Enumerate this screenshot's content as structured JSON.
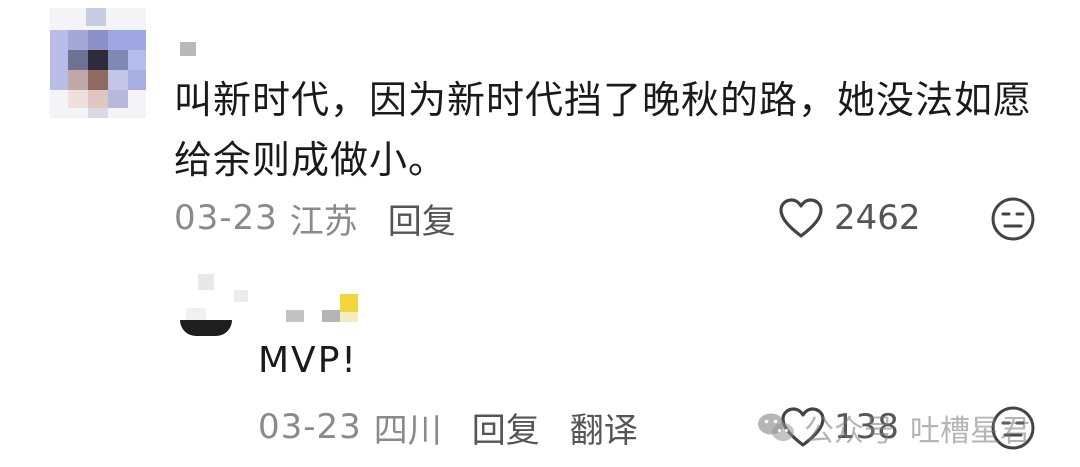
{
  "comment": {
    "text": "叫新时代，因为新时代挡了晚秋的路，她没法如愿给余则成做小。",
    "date": "03-23",
    "location": "江苏",
    "reply_label": "回复",
    "likes": "2462",
    "like_icon": "heart-outline-icon",
    "emoji_icon": "neutral-face-icon"
  },
  "reply": {
    "text": "MVP!",
    "date": "03-23",
    "location": "四川",
    "reply_label": "回复",
    "translate_label": "翻译",
    "likes": "138",
    "like_icon": "heart-outline-icon",
    "emoji_icon": "neutral-face-icon"
  },
  "watermark": {
    "prefix": "公众号",
    "name": "吐槽星君",
    "icon": "wechat-logo-icon"
  },
  "colors": {
    "text_primary": "#1a1a1a",
    "text_secondary": "#8a8a8a",
    "icon": "#444444"
  }
}
